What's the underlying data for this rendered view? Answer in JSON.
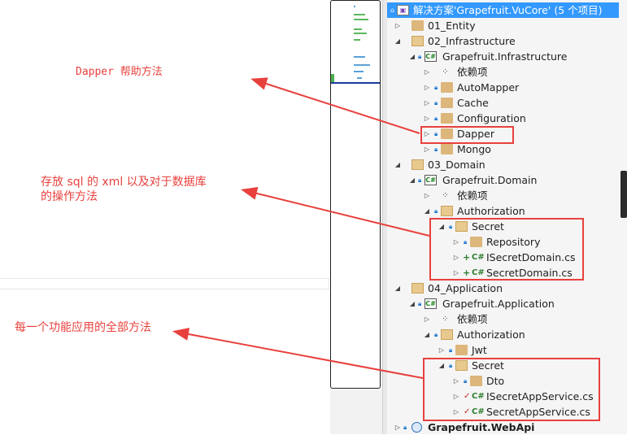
{
  "annotations": {
    "dapper": "Dapper 帮助方法",
    "sql_line1": "存放 sql 的 xml 以及对于数据库",
    "sql_line2": "的操作方法",
    "app": "每一个功能应用的全部方法"
  },
  "solution": {
    "title": "解决方案'Grapefruit.VuCore' (5 个项目)",
    "items": [
      {
        "label": "01_Entity"
      },
      {
        "label": "02_Infrastructure"
      },
      {
        "label": "Grapefruit.Infrastructure"
      },
      {
        "label": "依赖项"
      },
      {
        "label": "AutoMapper"
      },
      {
        "label": "Cache"
      },
      {
        "label": "Configuration"
      },
      {
        "label": "Dapper"
      },
      {
        "label": "Mongo"
      },
      {
        "label": "03_Domain"
      },
      {
        "label": "Grapefruit.Domain"
      },
      {
        "label": "依赖项"
      },
      {
        "label": "Authorization"
      },
      {
        "label": "Secret"
      },
      {
        "label": "Repository"
      },
      {
        "label": "ISecretDomain.cs"
      },
      {
        "label": "SecretDomain.cs"
      },
      {
        "label": "04_Application"
      },
      {
        "label": "Grapefruit.Application"
      },
      {
        "label": "依赖项"
      },
      {
        "label": "Authorization"
      },
      {
        "label": "Jwt"
      },
      {
        "label": "Secret"
      },
      {
        "label": "Dto"
      },
      {
        "label": "ISecretAppService.cs"
      },
      {
        "label": "SecretAppService.cs"
      },
      {
        "label": "Grapefruit.WebApi"
      }
    ]
  },
  "icons": {
    "csharp": "C#",
    "csproj": "C#"
  },
  "colors": {
    "annotation": "#e8413d",
    "selection": "#3399ff"
  }
}
